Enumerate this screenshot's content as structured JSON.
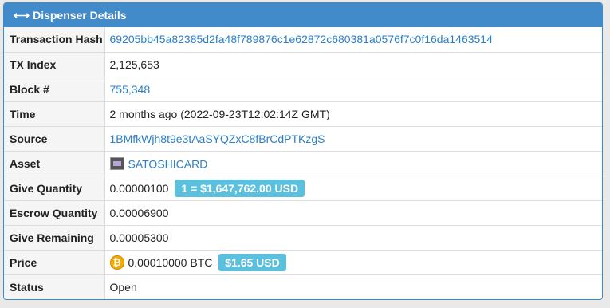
{
  "panel": {
    "title": "Dispenser Details",
    "title_icon": "left-right-arrow-icon"
  },
  "rows": {
    "tx_hash": {
      "label": "Transaction Hash",
      "value": "69205bb45a82385d2fa48f789876c1e62872c680381a0576f7c0f16da1463514"
    },
    "tx_index": {
      "label": "TX Index",
      "value": "2,125,653"
    },
    "block": {
      "label": "Block #",
      "value": "755,348"
    },
    "time": {
      "label": "Time",
      "value": "2 months ago (2022-09-23T12:02:14Z GMT)"
    },
    "source": {
      "label": "Source",
      "value": "1BMfkWjh8t9e3tAaSYQZxC8fBrCdPTKzgS"
    },
    "asset": {
      "label": "Asset",
      "value": "SATOSHICARD",
      "icon": "asset-thumbnail"
    },
    "give_quantity": {
      "label": "Give Quantity",
      "value": "0.00000100",
      "badge": "1 = $1,647,762.00 USD"
    },
    "escrow_quantity": {
      "label": "Escrow Quantity",
      "value": "0.00006900"
    },
    "give_remaining": {
      "label": "Give Remaining",
      "value": "0.00005300"
    },
    "price": {
      "label": "Price",
      "value": "0.00010000 BTC",
      "badge": "$1.65 USD",
      "icon": "bitcoin-icon"
    },
    "status": {
      "label": "Status",
      "value": "Open"
    }
  },
  "colors": {
    "header_bg": "#428bca",
    "link": "#2a7fc9",
    "badge_bg": "#5bc0de",
    "label_bg": "#f5f5f5",
    "bitcoin": "#f2a900"
  }
}
